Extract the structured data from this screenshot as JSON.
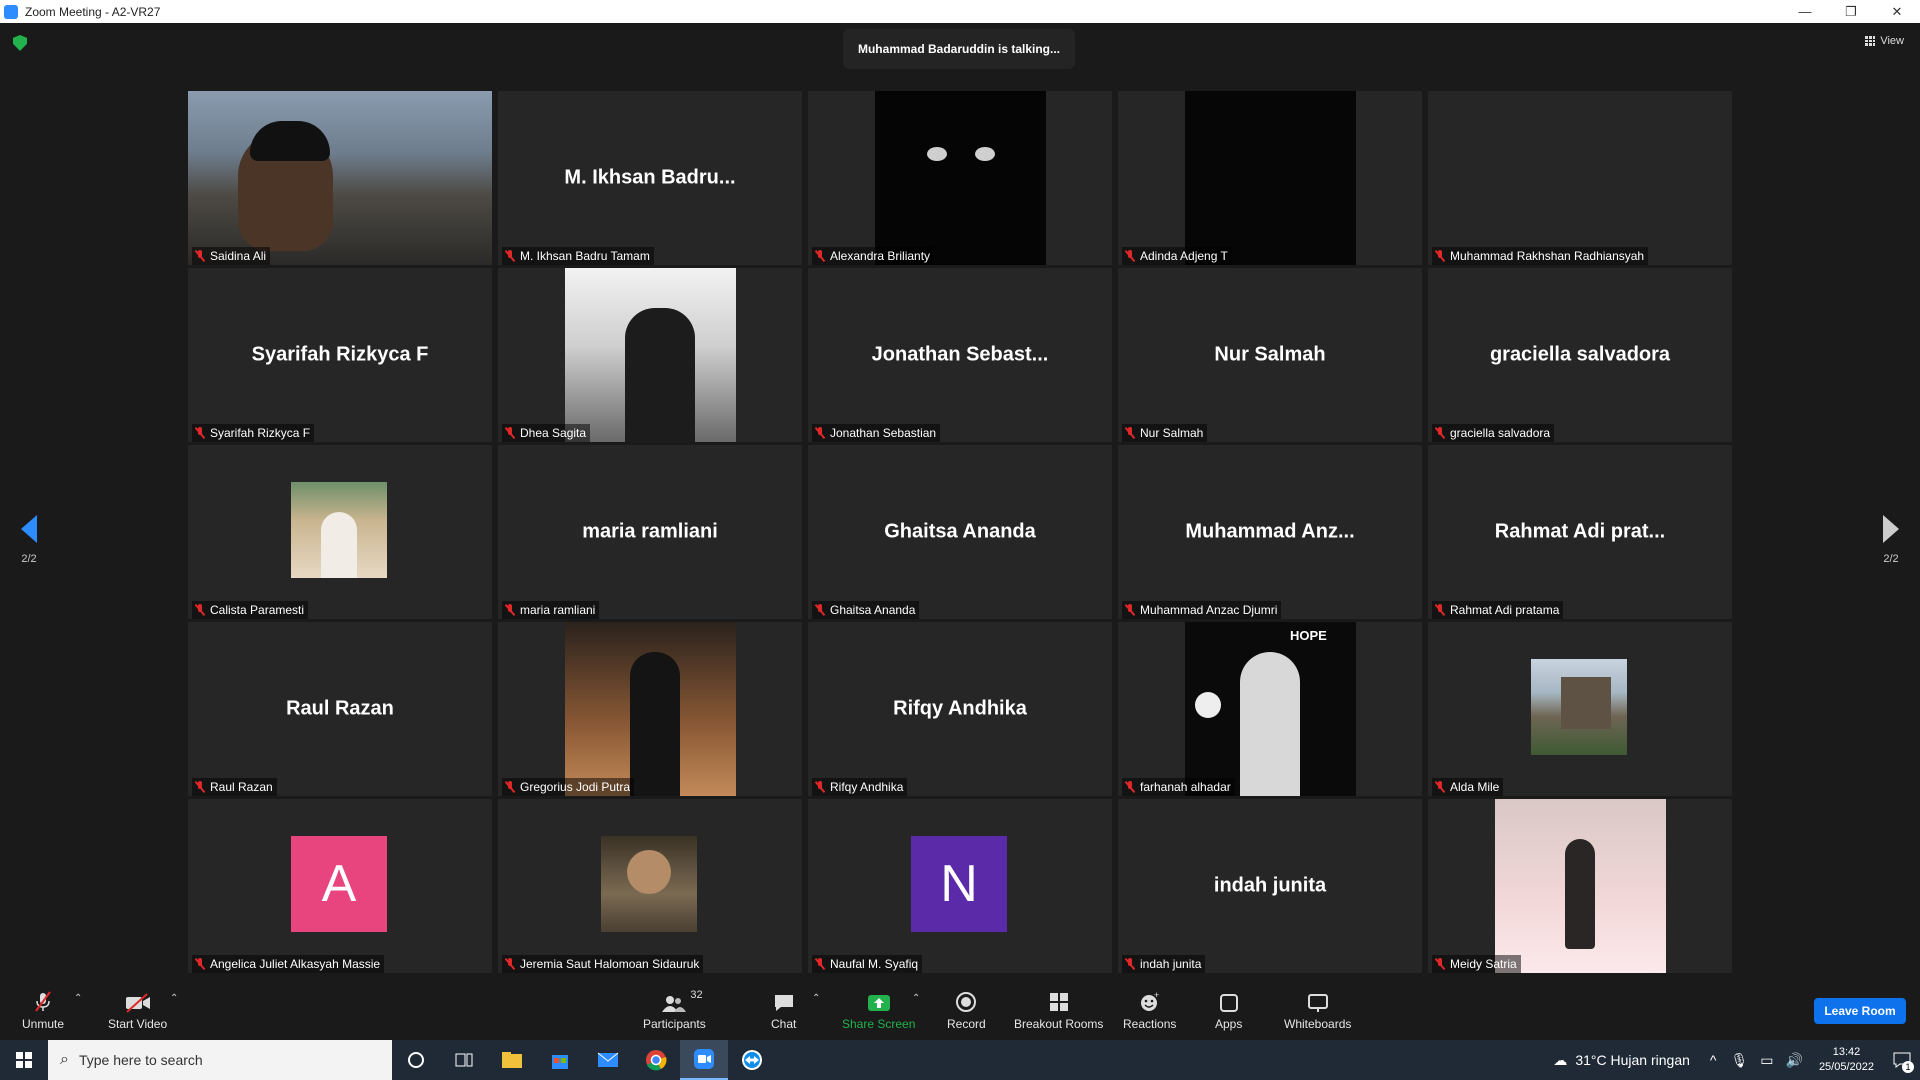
{
  "window": {
    "title": "Zoom Meeting - A2-VR27",
    "minimize": "—",
    "restore": "❐",
    "close": "✕"
  },
  "meeting": {
    "talking_banner": "Muhammad Badaruddin is talking...",
    "view_label": "View",
    "page_indicator_left": "2/2",
    "page_indicator_right": "2/2"
  },
  "participants": [
    {
      "label": "Saidina Ali",
      "display": "",
      "type": "video"
    },
    {
      "label": "M. Ikhsan Badru Tamam",
      "display": "M. Ikhsan Badru...",
      "type": "name"
    },
    {
      "label": "Alexandra Brilianty",
      "display": "",
      "type": "photo-cat"
    },
    {
      "label": "Adinda Adjeng T",
      "display": "",
      "type": "photo-black"
    },
    {
      "label": "Muhammad Rakhshan Radhiansyah",
      "display": "",
      "type": "blank"
    },
    {
      "label": "Syarifah Rizkyca F",
      "display": "Syarifah Rizkyca F",
      "type": "name"
    },
    {
      "label": "Dhea Sagita",
      "display": "",
      "type": "photo-bw"
    },
    {
      "label": "Jonathan Sebastian",
      "display": "Jonathan Sebast...",
      "type": "name"
    },
    {
      "label": "Nur Salmah",
      "display": "Nur Salmah",
      "type": "name"
    },
    {
      "label": "graciella salvadora",
      "display": "graciella salvadora",
      "type": "name"
    },
    {
      "label": "Calista Paramesti",
      "display": "",
      "type": "photo-small"
    },
    {
      "label": "maria ramliani",
      "display": "maria ramliani",
      "type": "name"
    },
    {
      "label": "Ghaitsa Ananda",
      "display": "Ghaitsa Ananda",
      "type": "name"
    },
    {
      "label": "Muhammad Anzac Djumri",
      "display": "Muhammad  Anz...",
      "type": "name"
    },
    {
      "label": "Rahmat Adi pratama",
      "display": "Rahmat Adi prat...",
      "type": "name"
    },
    {
      "label": "Raul Razan",
      "display": "Raul Razan",
      "type": "name"
    },
    {
      "label": "Gregorius Jodi Putra",
      "display": "",
      "type": "photo-suit"
    },
    {
      "label": "Rifqy Andhika",
      "display": "Rifqy Andhika",
      "type": "name"
    },
    {
      "label": "farhanah alhadar",
      "display": "",
      "type": "photo-hope"
    },
    {
      "label": "Alda Mile",
      "display": "",
      "type": "photo-building"
    },
    {
      "label": "Angelica Juliet Alkasyah Massie",
      "display": "A",
      "type": "initial-pink"
    },
    {
      "label": "Jeremia Saut Halomoan Sidauruk",
      "display": "",
      "type": "photo-small-dark"
    },
    {
      "label": "Naufal M. Syafiq",
      "display": "N",
      "type": "initial-purple"
    },
    {
      "label": "indah junita",
      "display": "indah junita",
      "type": "name"
    },
    {
      "label": "Meidy Satria",
      "display": "",
      "type": "photo-pink"
    }
  ],
  "photo_hope_text": "HOPE",
  "toolbar": {
    "unmute": "Unmute",
    "start_video": "Start Video",
    "participants": "Participants",
    "participants_count": "32",
    "chat": "Chat",
    "share_screen": "Share Screen",
    "record": "Record",
    "breakout_rooms": "Breakout Rooms",
    "reactions": "Reactions",
    "apps": "Apps",
    "whiteboards": "Whiteboards",
    "leave_room": "Leave Room"
  },
  "taskbar": {
    "search_placeholder": "Type here to search",
    "weather": "31°C  Hujan ringan",
    "time": "13:42",
    "date": "25/05/2022",
    "notification_count": "1"
  },
  "colors": {
    "accent": "#0e72ed",
    "muted_mic": "#e02828",
    "share_green": "#23b14d",
    "initial_pink": "#e8457f",
    "initial_purple": "#5a2aa8"
  }
}
